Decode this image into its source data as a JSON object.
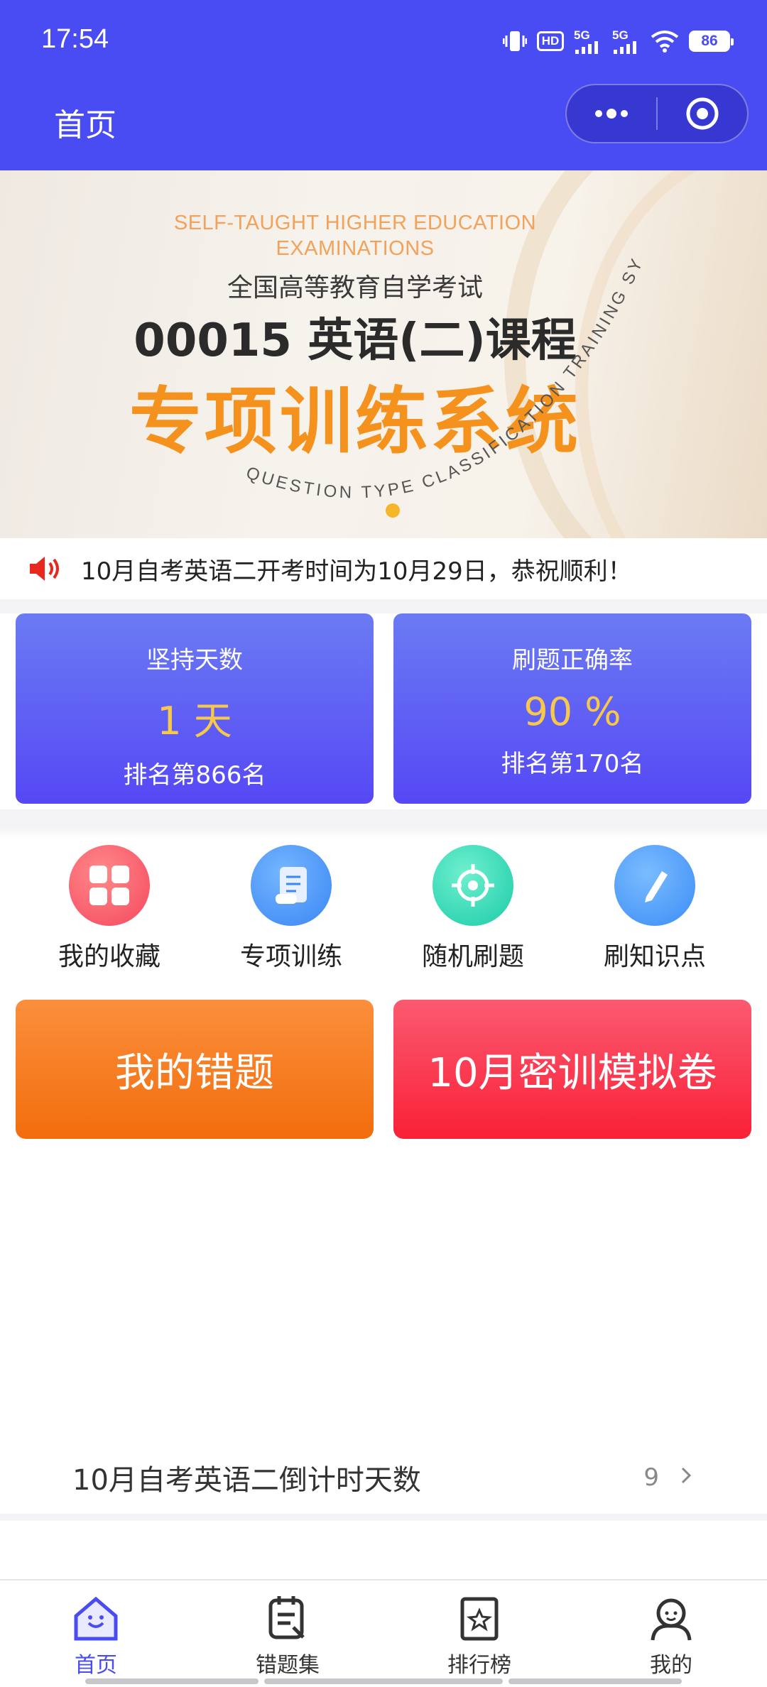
{
  "status_bar": {
    "time": "17:54",
    "hd": "HD",
    "signal1": "5G",
    "signal2": "5G",
    "battery": "86"
  },
  "header": {
    "title": "首页"
  },
  "banner": {
    "en_title_line1": "SELF-TAUGHT HIGHER EDUCATION",
    "en_title_line2": "EXAMINATIONS",
    "cn_subtitle": "全国高等教育自学考试",
    "course": "00015 英语(二)课程",
    "main_title": "专项训练系统",
    "curve_text": "QUESTION TYPE CLASSIFICATION TRAINING SYSTEM"
  },
  "notice": {
    "text": "10月自考英语二开考时间为10月29日，恭祝顺利！"
  },
  "stats": [
    {
      "label": "坚持天数",
      "value": "1 天",
      "rank": "排名第866名"
    },
    {
      "label": "刷题正确率",
      "value": "90 %",
      "rank": "排名第170名"
    }
  ],
  "quick_actions": [
    {
      "label": "我的收藏",
      "icon": "grid-icon",
      "color": "#f8566a"
    },
    {
      "label": "专项训练",
      "icon": "document-icon",
      "color": "#3d8ff5"
    },
    {
      "label": "随机刷题",
      "icon": "target-icon",
      "color": "#22d3b4"
    },
    {
      "label": "刷知识点",
      "icon": "pencil-icon",
      "color": "#3e93f7"
    }
  ],
  "big_buttons": {
    "wrong_questions": "我的错题",
    "mock_exam": "10月密训模拟卷"
  },
  "countdown": {
    "label": "10月自考英语二倒计时天数",
    "value": "9"
  },
  "tabbar": [
    {
      "label": "首页",
      "icon": "home-icon",
      "active": true
    },
    {
      "label": "错题集",
      "icon": "notebook-icon",
      "active": false
    },
    {
      "label": "排行榜",
      "icon": "ranking-star-icon",
      "active": false
    },
    {
      "label": "我的",
      "icon": "person-icon",
      "active": false
    }
  ],
  "colors": {
    "primary": "#4a4cf3",
    "accent_yellow": "#f8c84a",
    "orange": "#f26d0c",
    "red": "#f92036"
  }
}
